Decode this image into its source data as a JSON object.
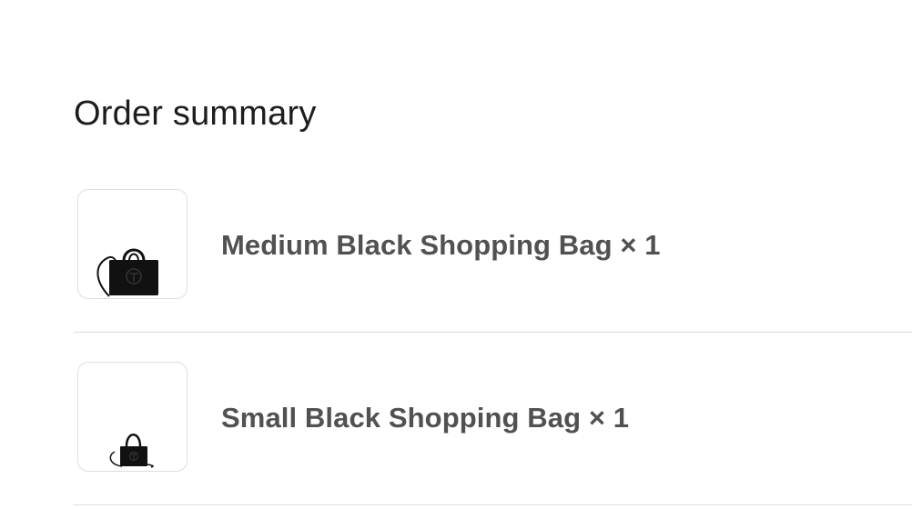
{
  "summary": {
    "title": "Order summary"
  },
  "items": [
    {
      "name": "Medium Black Shopping Bag × 1",
      "image": "medium-black-bag-image"
    },
    {
      "name": "Small Black Shopping Bag × 1",
      "image": "small-black-bag-image"
    }
  ],
  "colors": {
    "title": "#1d1d1f",
    "item_text": "#515151",
    "divider": "#dcdcdc",
    "bag": "#111111"
  }
}
